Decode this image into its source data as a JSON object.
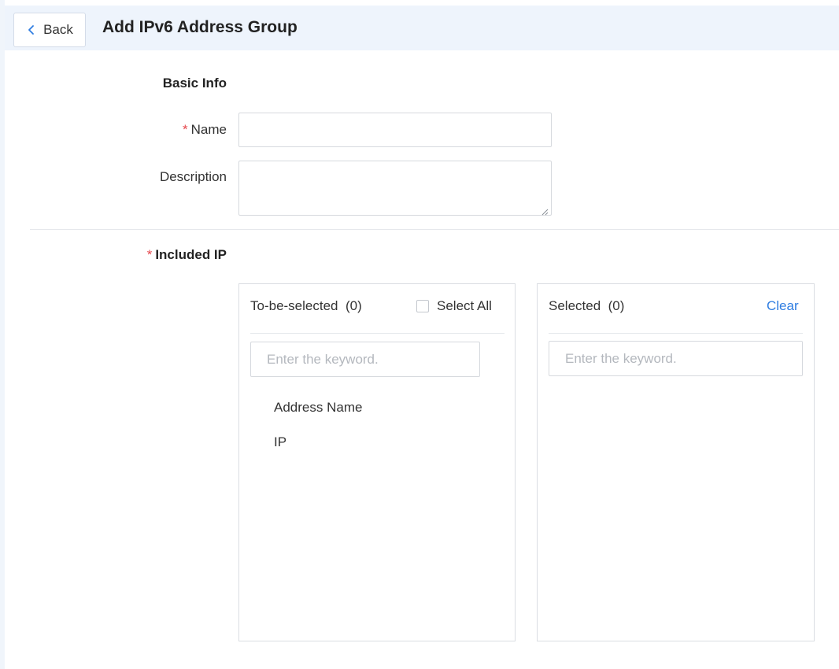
{
  "header": {
    "back_label": "Back",
    "title": "Add IPv6 Address Group"
  },
  "basic_info": {
    "section_title": "Basic Info",
    "name_required_mark": "*",
    "name_label": "Name",
    "name_value": "",
    "description_label": "Description",
    "description_value": ""
  },
  "included_ip": {
    "required_mark": "*",
    "section_title": "Included IP",
    "to_be_selected": {
      "title": "To-be-selected",
      "count": "(0)",
      "select_all_label": "Select All",
      "search_placeholder": "Enter the keyword.",
      "columns": [
        "Address Name",
        "IP"
      ]
    },
    "selected": {
      "title": "Selected",
      "count": "(0)",
      "clear_label": "Clear",
      "search_placeholder": "Enter the keyword."
    }
  },
  "colors": {
    "header_bg": "#eef4fc",
    "accent_link": "#2f7de1",
    "required": "#e5484d",
    "border": "#d6d9de"
  },
  "icons": {
    "back": "chevron-left-icon",
    "resize": "resize-grip-icon"
  }
}
